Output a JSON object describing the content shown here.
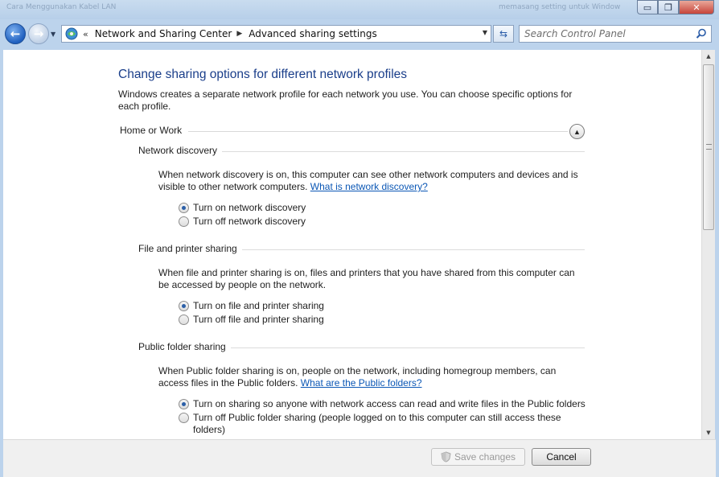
{
  "window": {
    "ghost_title_left": "Cara Menggunakan Kabel LAN",
    "ghost_title_right": "memasang setting untuk Window",
    "minimize_glyph": "▭",
    "maximize_glyph": "❐",
    "close_glyph": "✕"
  },
  "navigation": {
    "back_glyph": "←",
    "forward_glyph": "→",
    "breadcrumb_overflow": "«",
    "breadcrumb": [
      "Network and Sharing Center",
      "Advanced sharing settings"
    ],
    "search_placeholder": "Search Control Panel",
    "icons": {
      "address_icon": "control-panel-icon",
      "refresh": "refresh-icon",
      "search": "search-icon"
    }
  },
  "page": {
    "title": "Change sharing options for different network profiles",
    "intro": "Windows creates a separate network profile for each network you use. You can choose specific options for each profile.",
    "profile": {
      "name": "Home or Work",
      "expanded": true,
      "collapse_glyph": "▲"
    },
    "sections": [
      {
        "heading": "Network discovery",
        "description": "When network discovery is on, this computer can see other network computers and devices and is visible to other network computers.",
        "link": "What is network discovery?",
        "options": [
          {
            "label": "Turn on network discovery",
            "checked": true
          },
          {
            "label": "Turn off network discovery",
            "checked": false
          }
        ]
      },
      {
        "heading": "File and printer sharing",
        "description": "When file and printer sharing is on, files and printers that you have shared from this computer can be accessed by people on the network.",
        "link": "",
        "options": [
          {
            "label": "Turn on file and printer sharing",
            "checked": true
          },
          {
            "label": "Turn off file and printer sharing",
            "checked": false
          }
        ]
      },
      {
        "heading": "Public folder sharing",
        "description": "When Public folder sharing is on, people on the network, including homegroup members, can access files in the Public folders.",
        "link": "What are the Public folders?",
        "options": [
          {
            "label": "Turn on sharing so anyone with network access can read and write files in the Public folders",
            "checked": true
          },
          {
            "label": "Turn off Public folder sharing (people logged on to this computer can still access these folders)",
            "checked": false
          }
        ]
      }
    ]
  },
  "footer": {
    "save_label": "Save changes",
    "save_enabled": false,
    "cancel_label": "Cancel"
  },
  "colors": {
    "title_blue": "#1a3e8a",
    "link_blue": "#0b57b5",
    "frame": "#bcd3ec"
  }
}
